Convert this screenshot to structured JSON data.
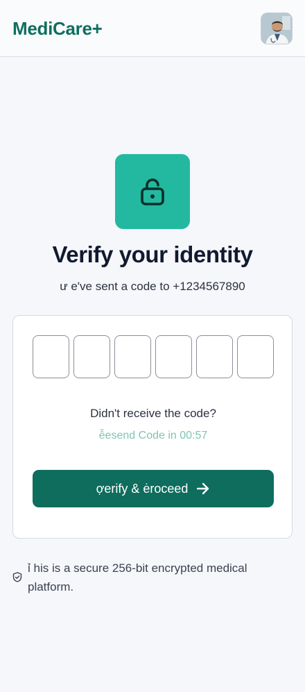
{
  "header": {
    "brand": "MediCare+",
    "avatar_icon": "doctor-avatar"
  },
  "hero": {
    "icon": "lock-open-icon",
    "title": "Verify your identity",
    "subtitle_prefix": "ư e've sent a code to ",
    "phone": "+1234567890"
  },
  "otp": {
    "digits": [
      "",
      "",
      "",
      "",
      "",
      ""
    ]
  },
  "resend": {
    "question": "Didn't receive the code?",
    "countdown_label": "ễesend Code in 00:57"
  },
  "action": {
    "verify_label": "ợerify & ėroceed",
    "icon": "arrow-right-icon"
  },
  "footer": {
    "icon": "shield-check-icon",
    "note": "ỉ his is a secure 256-bit encrypted medical platform."
  },
  "colors": {
    "brand": "#0e6f5f",
    "accent_tile": "#23b9a0",
    "button": "#0e6d5d",
    "resend_text": "#7fc4b4"
  }
}
